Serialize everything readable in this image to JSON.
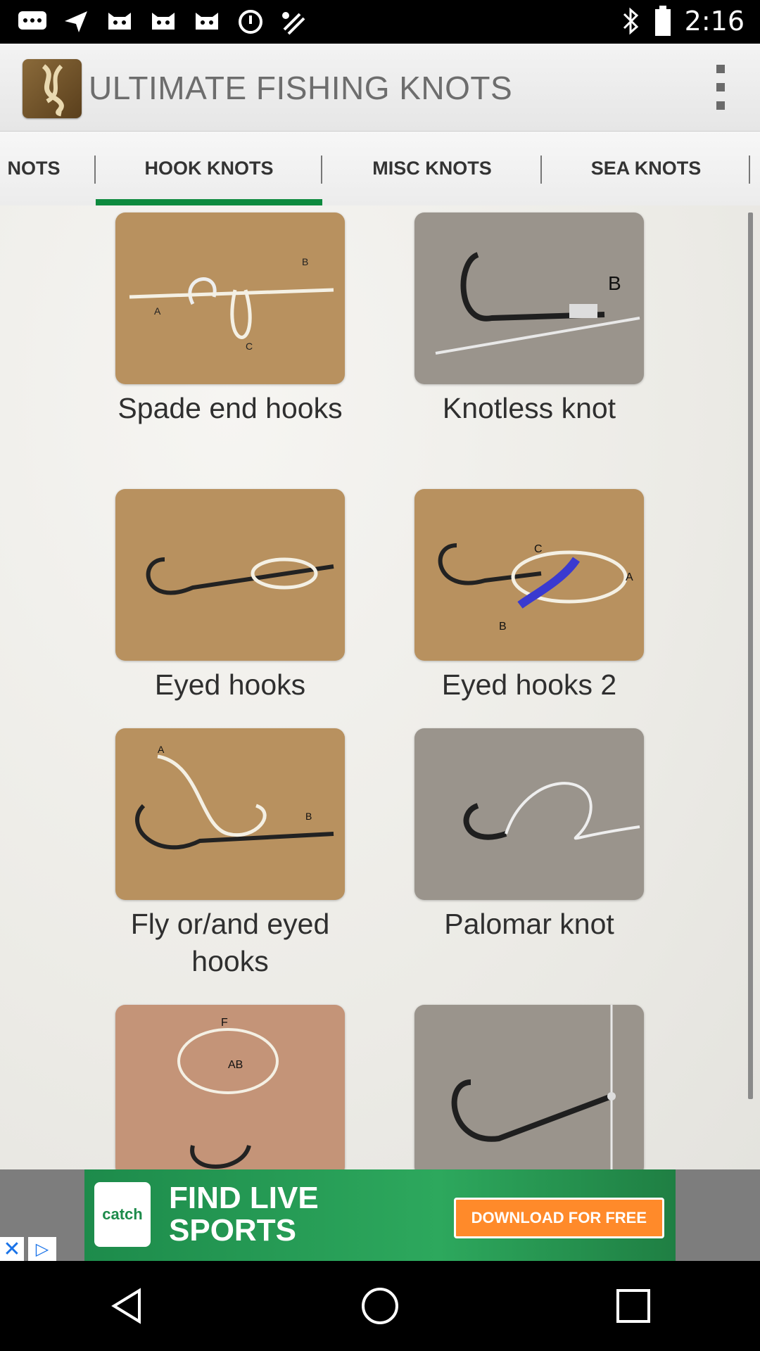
{
  "status_bar": {
    "time": "2:16",
    "left_icons": [
      "message-icon",
      "navigation-icon",
      "cat-face-icon",
      "cat-face-icon",
      "cat-face-icon",
      "alarm-icon",
      "satellite-icon"
    ],
    "right_icons": [
      "bluetooth-icon",
      "battery-icon"
    ]
  },
  "app_bar": {
    "title": "ULTIMATE FISHING KNOTS",
    "logo_icon": "knot-logo-icon",
    "menu_icon": "overflow-menu-icon"
  },
  "tabs": [
    {
      "label": "NOTS",
      "active": false
    },
    {
      "label": "HOOK KNOTS",
      "active": true
    },
    {
      "label": "MISC KNOTS",
      "active": false
    },
    {
      "label": "SEA KNOTS",
      "active": false
    }
  ],
  "accent_color": "#0d8a3e",
  "knots": [
    {
      "label": "Spade end hooks",
      "image": "spade-end-hooks-image"
    },
    {
      "label": "Knotless knot",
      "image": "knotless-knot-image"
    },
    {
      "label": "Eyed hooks",
      "image": "eyed-hooks-image"
    },
    {
      "label": "Eyed hooks 2",
      "image": "eyed-hooks-2-image"
    },
    {
      "label": "Fly or/and eyed hooks",
      "image": "fly-eyed-hooks-image"
    },
    {
      "label": "Palomar knot",
      "image": "palomar-knot-image"
    },
    {
      "label": "",
      "image": "knot-diagram-image"
    },
    {
      "label": "",
      "image": "hook-line-image"
    }
  ],
  "ad": {
    "brand": "catch",
    "headline": "FIND LIVE SPORTS",
    "cta": "DOWNLOAD FOR FREE"
  },
  "nav": [
    "back-icon",
    "home-icon",
    "recents-icon"
  ]
}
